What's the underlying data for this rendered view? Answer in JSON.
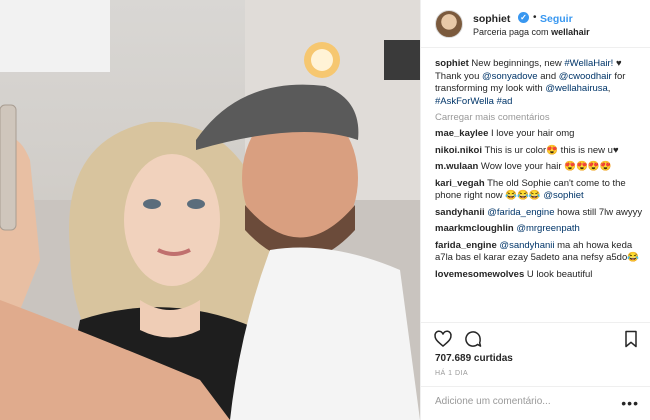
{
  "post": {
    "username": "sophiet",
    "verified_mark": "✓",
    "separator": "•",
    "follow_label": "Seguir",
    "partnership_prefix": "Parceria paga com",
    "partner_name": "wellahair"
  },
  "caption": {
    "username": "sophiet",
    "text_parts": [
      {
        "t": " New beginnings, new ",
        "link": false
      },
      {
        "t": "#WellaHair!",
        "link": true
      },
      {
        "t": " ♥ Thank you ",
        "link": false
      },
      {
        "t": "@sonyadove",
        "link": true
      },
      {
        "t": " and ",
        "link": false
      },
      {
        "t": "@cwoodhair",
        "link": true
      },
      {
        "t": " for transforming my look with ",
        "link": false
      },
      {
        "t": "@wellahairusa",
        "link": true
      },
      {
        "t": ", ",
        "link": false
      },
      {
        "t": "#AskForWella",
        "link": true
      },
      {
        "t": " ",
        "link": false
      },
      {
        "t": "#ad",
        "link": true
      }
    ]
  },
  "load_more_label": "Carregar mais comentários",
  "comments": [
    {
      "user": "mae_kaylee",
      "text": " I love your hair omg"
    },
    {
      "user": "nikoi.nikoi",
      "text": " This is ur color😍 this is new u♥"
    },
    {
      "user": "m.wulaan",
      "text": " Wow love your hair 😍😍😍😍"
    },
    {
      "user": "kari_vegah",
      "text": " The old Sophie can't come to the phone right now 😂😂😂 ",
      "mention": "@sophiet"
    },
    {
      "user": "sandyhanii",
      "text": " ",
      "mention": "@farida_engine",
      "after": " howa still 7lw awyyy"
    },
    {
      "user": "maarkmcloughlin",
      "text": " ",
      "mention": "@mrgreenpath"
    },
    {
      "user": "farida_engine",
      "text": " ",
      "mention": "@sandyhanii",
      "after": " ma ah howa keda a7la bas el karar ezay 5adeto ana nefsy a5do😂"
    },
    {
      "user": "lovemesomewolves",
      "text": " U look beautiful"
    }
  ],
  "likes_label": "707.689 curtidas",
  "time_label": "HÁ 1 DIA",
  "add_comment_placeholder": "Adicione um comentário...",
  "more_options": "•••",
  "icons": {
    "like": "heart-icon",
    "comment": "comment-icon",
    "save": "bookmark-icon"
  },
  "colors": {
    "link": "#003569",
    "accent_blue": "#3897f0",
    "muted": "#999999"
  }
}
